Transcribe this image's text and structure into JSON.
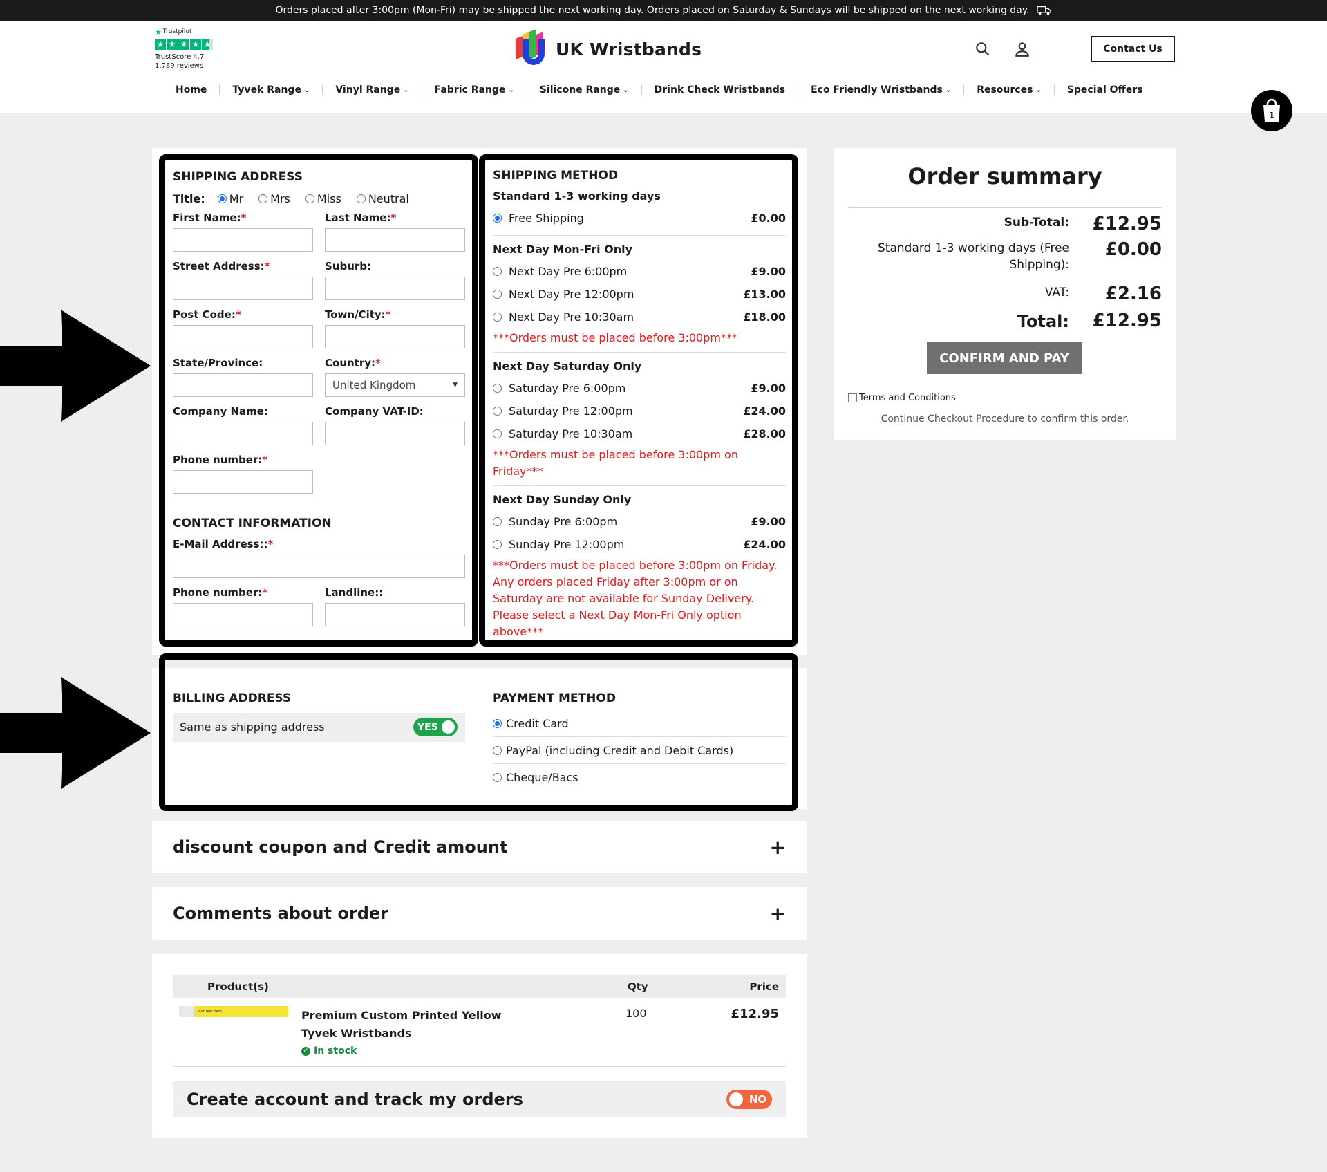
{
  "banner": {
    "text": "Orders placed after 3:00pm (Mon-Fri) may be shipped the next working day. Orders placed on Saturday & Sundays will be shipped on the next working day.",
    "icon": "truck-icon"
  },
  "trustpilot": {
    "brand": "Trustpilot",
    "score": "TrustScore 4.7",
    "reviews": "1,789 reviews",
    "rating": 4.7
  },
  "header": {
    "brand": "UK Wristbands",
    "contact_label": "Contact Us",
    "cart_count": "1"
  },
  "nav": [
    {
      "label": "Home",
      "dropdown": false
    },
    {
      "label": "Tyvek Range",
      "dropdown": true
    },
    {
      "label": "Vinyl Range",
      "dropdown": true
    },
    {
      "label": "Fabric Range",
      "dropdown": true
    },
    {
      "label": "Silicone Range",
      "dropdown": true
    },
    {
      "label": "Drink Check Wristbands",
      "dropdown": false
    },
    {
      "label": "Eco Friendly Wristbands",
      "dropdown": true
    },
    {
      "label": "Resources",
      "dropdown": true
    },
    {
      "label": "Special Offers",
      "dropdown": false
    }
  ],
  "shipping_address": {
    "title": "SHIPPING ADDRESS",
    "title_label": "Title:",
    "title_options": [
      "Mr",
      "Mrs",
      "Miss",
      "Neutral"
    ],
    "title_selected": "Mr",
    "first_name": "First Name:",
    "last_name": "Last Name:",
    "street": "Street Address:",
    "suburb": "Suburb:",
    "post_code": "Post Code:",
    "town": "Town/City:",
    "state": "State/Province:",
    "country": "Country:",
    "country_value": "United Kingdom",
    "company": "Company Name:",
    "vat": "Company VAT-ID:",
    "phone": "Phone number:",
    "required_mark": "*"
  },
  "contact_info": {
    "title": "CONTACT INFORMATION",
    "email": "E-Mail Address::",
    "phone": "Phone number:",
    "landline": "Landline::"
  },
  "shipping_method": {
    "title": "SHIPPING METHOD",
    "standard_group": "Standard 1-3 working days",
    "standard_option": {
      "label": "Free Shipping",
      "price": "£0.00"
    },
    "monfri_group": "Next Day Mon-Fri Only",
    "monfri_options": [
      {
        "label": "Next Day Pre 6:00pm",
        "price": "£9.00"
      },
      {
        "label": "Next Day Pre 12:00pm",
        "price": "£13.00"
      },
      {
        "label": "Next Day Pre 10:30am",
        "price": "£18.00"
      }
    ],
    "monfri_note": "***Orders must be placed before 3:00pm***",
    "saturday_group": "Next Day Saturday Only",
    "saturday_options": [
      {
        "label": "Saturday Pre 6:00pm",
        "price": "£9.00"
      },
      {
        "label": "Saturday Pre 12:00pm",
        "price": "£24.00"
      },
      {
        "label": "Saturday Pre 10:30am",
        "price": "£28.00"
      }
    ],
    "saturday_note": "***Orders must be placed before 3:00pm on Friday***",
    "sunday_group": "Next Day Sunday Only",
    "sunday_options": [
      {
        "label": "Sunday Pre 6:00pm",
        "price": "£9.00"
      },
      {
        "label": "Sunday Pre 12:00pm",
        "price": "£24.00"
      }
    ],
    "sunday_note": "***Orders must be placed before 3:00pm on Friday. Any orders placed Friday after 3:00pm or on Saturday are not available for Sunday Delivery. Please select a Next Day Mon-Fri Only option above***"
  },
  "order_summary": {
    "title": "Order summary",
    "subtotal_label": "Sub-Total:",
    "subtotal": "£12.95",
    "shipping_label": "Standard 1-3 working days (Free Shipping):",
    "shipping": "£0.00",
    "vat_label": "VAT:",
    "vat": "£2.16",
    "total_label": "Total:",
    "total": "£12.95",
    "confirm_label": "CONFIRM AND PAY",
    "terms_label": "Terms and Conditions",
    "hint": "Continue Checkout Procedure to confirm this order."
  },
  "billing": {
    "title": "BILLING ADDRESS",
    "same_label": "Same as shipping address",
    "toggle": "YES"
  },
  "payment": {
    "title": "PAYMENT METHOD",
    "options": [
      "Credit Card",
      "PayPal (including Credit and Debit Cards)",
      "Cheque/Bacs"
    ],
    "selected": "Credit Card"
  },
  "accordions": {
    "coupon": "discount coupon and Credit amount",
    "comments": "Comments about order"
  },
  "products": {
    "headers": {
      "product": "Product(s)",
      "qty": "Qty",
      "price": "Price"
    },
    "items": [
      {
        "name": "Premium Custom Printed Yellow Tyvek Wristbands",
        "qty": "100",
        "price": "£12.95",
        "stock": "In stock",
        "image_text": "Your Text Here"
      }
    ]
  },
  "create_account": {
    "label": "Create account and track my orders",
    "toggle": "NO"
  },
  "colors": {
    "accent_blue": "#1a73e8",
    "required_red": "#d9262b",
    "note_red": "#e01b1b",
    "toggle_green": "#1ea24a",
    "toggle_orange": "#f2643e",
    "confirm_grey": "#707070",
    "trustpilot_green": "#00b67a"
  }
}
